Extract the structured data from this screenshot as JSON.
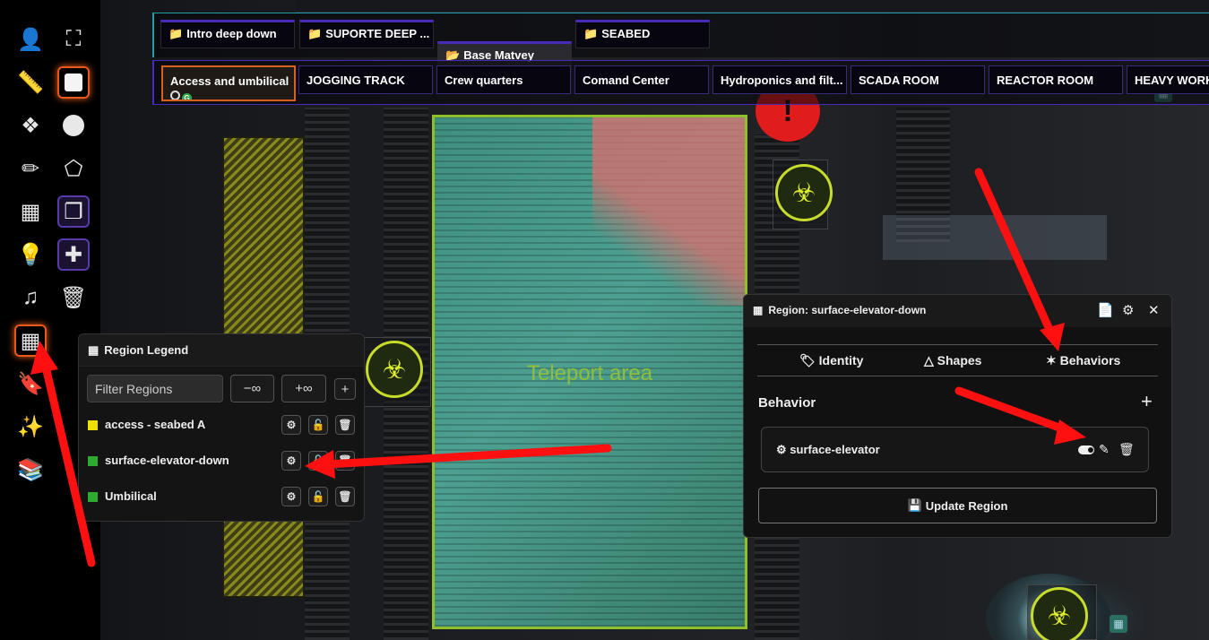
{
  "toolbar": {
    "tools": [
      "user-icon",
      "fullscreen-icon",
      "ruler-icon",
      "square-icon",
      "cubes-icon",
      "circle-icon",
      "pencil-icon",
      "polygon-icon",
      "wall-icon",
      "overlap-icon",
      "lightbulb-icon",
      "plus-icon",
      "music-icon",
      "trash-icon",
      "region-grid-icon",
      "bookmark-icon",
      "magic-wand-icon",
      "library-icon"
    ]
  },
  "navigation": {
    "folders": [
      "Intro deep down",
      "SUPORTE DEEP ...",
      "Base Matvey",
      "SEABED"
    ],
    "scenes": [
      "Access and umbilical",
      "JOGGING TRACK",
      "Crew quarters",
      "Comand Center",
      "Hydroponics and filt...",
      "SCADA ROOM",
      "REACTOR ROOM",
      "HEAVY WORK"
    ],
    "active_scene_badge": "G"
  },
  "map": {
    "teleport_label": "Teleport area",
    "alert_glyph": "!"
  },
  "legend": {
    "title": "Region Legend",
    "filter_placeholder": "Filter Regions",
    "btn_minus": "−∞",
    "btn_plus": "+∞",
    "btn_add": "+",
    "items": [
      {
        "name": "access - seabed A",
        "color": "#f0e000"
      },
      {
        "name": "surface-elevator-down",
        "color": "#2eaa2e"
      },
      {
        "name": "Umbilical",
        "color": "#2eaa2e"
      }
    ]
  },
  "config": {
    "title": "Region: surface-elevator-down",
    "tabs": [
      "Identity",
      "Shapes",
      "Behaviors"
    ],
    "active_tab": "Behaviors",
    "behavior_heading": "Behavior",
    "add_glyph": "+",
    "behavior_item": "surface-elevator",
    "update_label": "Update Region"
  },
  "colors": {
    "accent_orange": "#e85a1a",
    "accent_purple": "#4a2ab8",
    "teal": "#1aa1a8",
    "arrow_red": "#ff1010"
  }
}
